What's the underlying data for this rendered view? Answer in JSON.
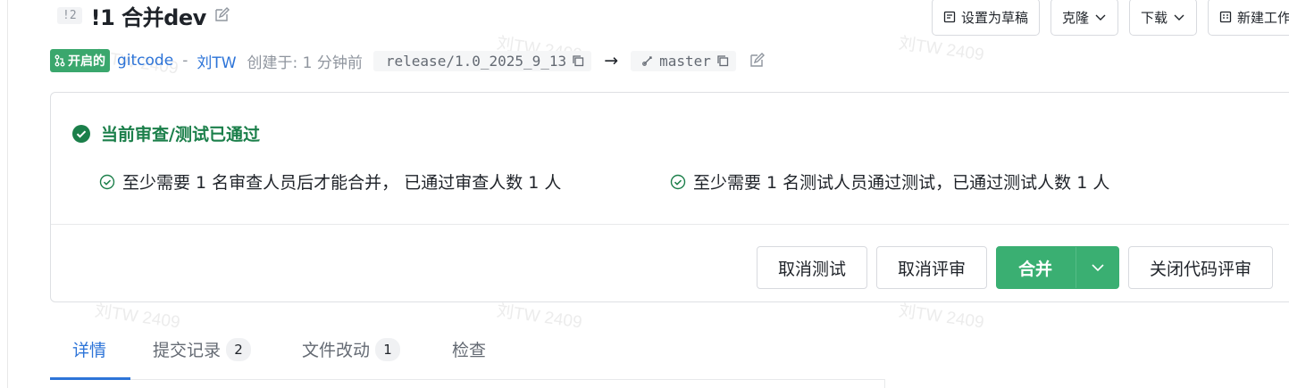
{
  "merge_request": {
    "iid_badge": "!2",
    "title": "!1 合并dev",
    "state_label": "开启的",
    "repo": "gitcode",
    "separator": "-",
    "author": "刘TW",
    "created": "创建于: 1 分钟前",
    "source_branch": "release/1.0_2025_9_13",
    "arrow": "→",
    "target_branch": "master"
  },
  "actions": {
    "draft": "设置为草稿",
    "clone": "克隆",
    "download": "下载",
    "new_work_item": "新建工作项"
  },
  "status_card": {
    "title": "当前审查/测试已通过",
    "review_check": "至少需要 1 名审查人员后才能合并， 已通过审查人数 1 人",
    "test_check": "至少需要 1 名测试人员通过测试，已通过测试人数 1 人",
    "buttons": {
      "cancel_test": "取消测试",
      "cancel_review": "取消评审",
      "merge": "合并",
      "close_review": "关闭代码评审"
    }
  },
  "tabs": [
    {
      "label": "详情",
      "count": null,
      "active": true
    },
    {
      "label": "提交记录",
      "count": "2",
      "active": false
    },
    {
      "label": "文件改动",
      "count": "1",
      "active": false
    },
    {
      "label": "检查",
      "count": null,
      "active": false
    }
  ],
  "watermark": "刘TW 2409",
  "colors": {
    "accent_blue": "#2d74d8",
    "success_green": "#3aaf72",
    "state_badge": "#3aa76d",
    "pass_text": "#1b7f4a"
  }
}
